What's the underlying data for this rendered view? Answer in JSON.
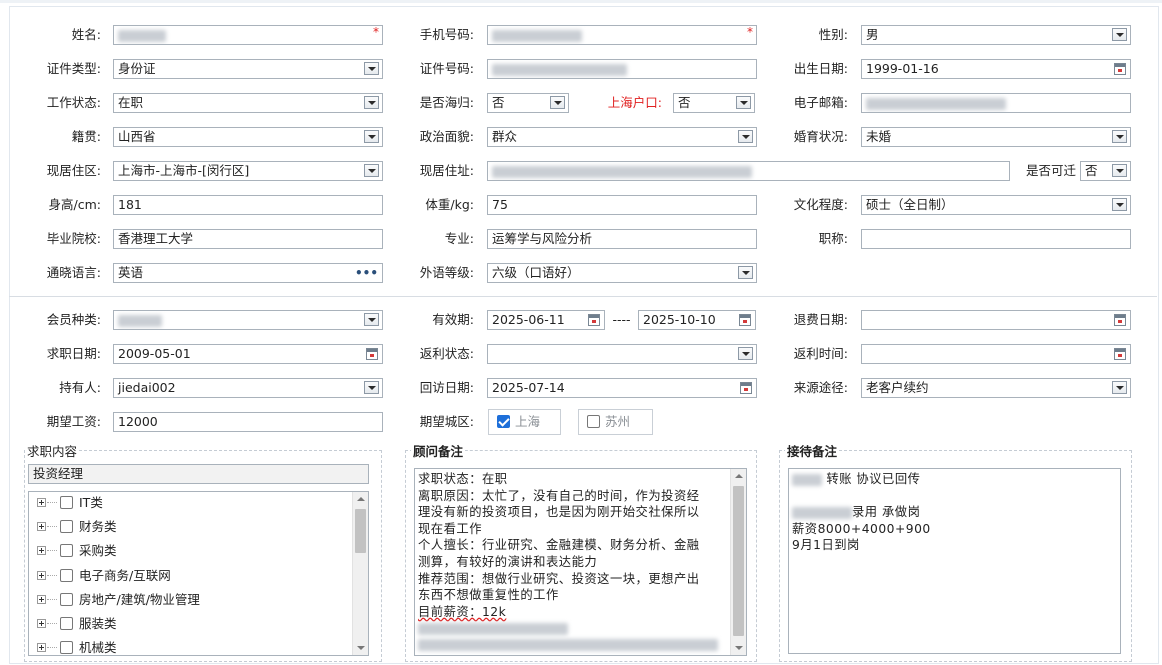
{
  "form": {
    "name": {
      "label": "姓名:"
    },
    "phone": {
      "label": "手机号码:"
    },
    "gender": {
      "label": "性别:",
      "value": "男"
    },
    "id_type": {
      "label": "证件类型:",
      "value": "身份证"
    },
    "id_number": {
      "label": "证件号码:"
    },
    "birth_date": {
      "label": "出生日期:",
      "value": "1999-01-16"
    },
    "work_status": {
      "label": "工作状态:",
      "value": "在职"
    },
    "overseas_returnee": {
      "label": "是否海归:",
      "value": "否"
    },
    "shanghai_hukou": {
      "label": "上海户口:",
      "value": "否"
    },
    "email": {
      "label": "电子邮箱:"
    },
    "native_place": {
      "label": "籍贯:",
      "value": "山西省"
    },
    "political_status": {
      "label": "政治面貌:",
      "value": "群众"
    },
    "marital_status": {
      "label": "婚育状况:",
      "value": "未婚"
    },
    "residence_area": {
      "label": "现居住区:",
      "value": "上海市-上海市-[闵行区]"
    },
    "current_address": {
      "label": "现居住址:"
    },
    "relocatable": {
      "label": "是否可迁",
      "value": "否"
    },
    "height": {
      "label": "身高/cm:",
      "value": "181"
    },
    "weight": {
      "label": "体重/kg:",
      "value": "75"
    },
    "education": {
      "label": "文化程度:",
      "value": "硕士（全日制）"
    },
    "school": {
      "label": "毕业院校:",
      "value": "香港理工大学"
    },
    "major": {
      "label": "专业:",
      "value": "运筹学与风险分析"
    },
    "title": {
      "label": "职称:",
      "value": ""
    },
    "languages": {
      "label": "通晓语言:",
      "value": "英语"
    },
    "foreign_level": {
      "label": "外语等级:",
      "value": "六级（口语好）"
    },
    "member_type": {
      "label": "会员种类:"
    },
    "valid_period": {
      "label": "有效期:",
      "start": "2025-06-11",
      "sep": "----",
      "end": "2025-10-10"
    },
    "refund_date": {
      "label": "退费日期:",
      "value": ""
    },
    "job_search_date": {
      "label": "求职日期:",
      "value": "2009-05-01"
    },
    "rebate_status": {
      "label": "返利状态:",
      "value": ""
    },
    "rebate_time": {
      "label": "返利时间:",
      "value": ""
    },
    "holder": {
      "label": "持有人:",
      "value": "jiedai002"
    },
    "revisit_date": {
      "label": "回访日期:",
      "value": "2025-07-14"
    },
    "source": {
      "label": "来源途径:",
      "value": "老客户续约"
    },
    "expected_salary": {
      "label": "期望工资:",
      "value": "12000"
    },
    "expected_city": {
      "label": "期望城区:",
      "options": [
        {
          "label": "上海",
          "checked": true
        },
        {
          "label": "苏州",
          "checked": false
        }
      ]
    }
  },
  "job_content": {
    "title": "求职内容",
    "selected": "投资经理",
    "tree": [
      "IT类",
      "财务类",
      "采购类",
      "电子商务/互联网",
      "房地产/建筑/物业管理",
      "服装类",
      "机械类"
    ]
  },
  "advisor_notes": {
    "title": "顾问备注",
    "lines": [
      "求职状态：在职",
      "离职原因：太忙了，没有自己的时间，作为投资经",
      "理没有新的投资项目，也是因为刚开始交社保所以",
      "现在看工作",
      "个人擅长：行业研究、金融建模、财务分析、金融",
      "测算，有较好的演讲和表达能力",
      "推荐范围：想做行业研究、投资这一块，更想产出",
      "东西不想做重复性的工作",
      "目前薪资：12k"
    ]
  },
  "reception_notes": {
    "title": "接待备注",
    "line1": "转账 协议已回传",
    "line2": "录用 承做岗",
    "line3": "薪资8000+4000+900",
    "line4": "9月1日到岗"
  }
}
